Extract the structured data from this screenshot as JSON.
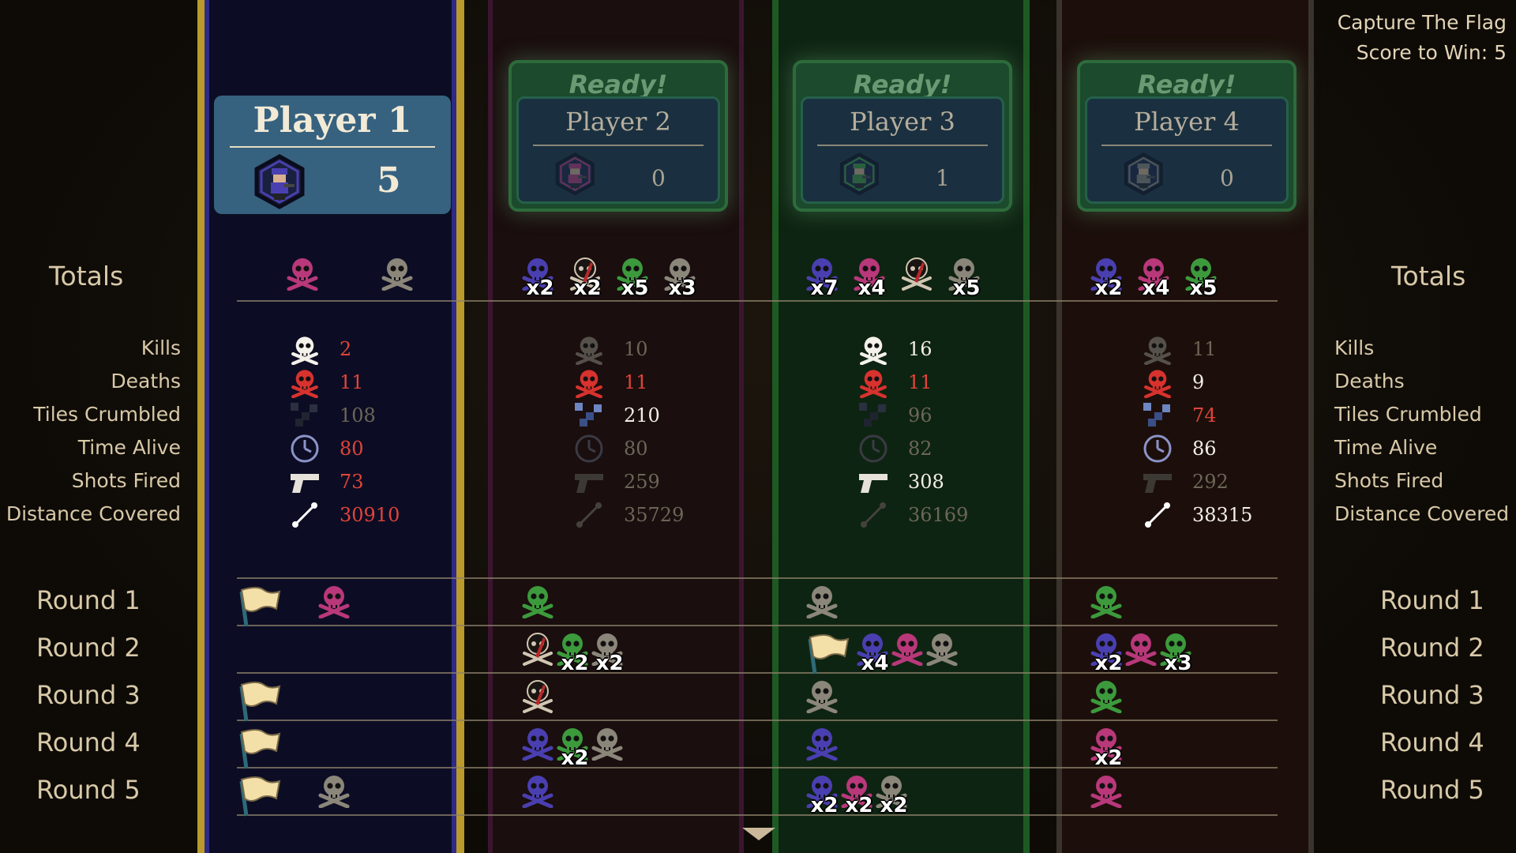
{
  "mode": {
    "title": "Capture The Flag",
    "score_to_win": "Score to Win: 5"
  },
  "labels": {
    "totals": "Totals",
    "stats": [
      "Kills",
      "Deaths",
      "Tiles Crumbled",
      "Time Alive",
      "Shots Fired",
      "Distance Covered"
    ],
    "rounds": [
      "Round 1",
      "Round 2",
      "Round 3",
      "Round 4",
      "Round 5"
    ]
  },
  "colors": {
    "purple": "#4a3fb0",
    "magenta": "#b8387a",
    "green": "#3c9a3c",
    "grey": "#8b867a",
    "red_text": "#e0443a",
    "white_text": "#f2eee4",
    "dim_text": "#6c6657"
  },
  "players": [
    {
      "name": "Player 1",
      "score": "5",
      "ready": "",
      "active": true,
      "column_color": "purple",
      "totals": [
        {
          "color": "magenta",
          "mult": ""
        },
        {
          "color": "grey",
          "mult": ""
        }
      ],
      "stats": [
        {
          "icon": "skull-icon",
          "value": "2",
          "tone": "red"
        },
        {
          "icon": "red-skull-icon",
          "value": "11",
          "tone": "red"
        },
        {
          "icon": "tiles-icon",
          "value": "108",
          "tone": "dim"
        },
        {
          "icon": "clock-icon",
          "value": "80",
          "tone": "red"
        },
        {
          "icon": "pistol-icon",
          "value": "73",
          "tone": "red"
        },
        {
          "icon": "distance-icon",
          "value": "30910",
          "tone": "red"
        }
      ],
      "rounds": [
        {
          "flag": true,
          "tokens": [
            {
              "color": "magenta",
              "mult": ""
            }
          ]
        },
        {
          "flag": false,
          "tokens": []
        },
        {
          "flag": true,
          "tokens": []
        },
        {
          "flag": true,
          "tokens": []
        },
        {
          "flag": true,
          "tokens": [
            {
              "color": "grey",
              "mult": ""
            }
          ]
        }
      ]
    },
    {
      "name": "Player 2",
      "score": "0",
      "ready": "Ready!",
      "active": false,
      "column_color": "magenta",
      "totals": [
        {
          "color": "purple",
          "mult": "x2"
        },
        {
          "color": "self",
          "mult": "x2"
        },
        {
          "color": "green",
          "mult": "x5"
        },
        {
          "color": "grey",
          "mult": "x3"
        }
      ],
      "stats": [
        {
          "icon": "skull-icon",
          "value": "10",
          "tone": "dim"
        },
        {
          "icon": "red-skull-icon",
          "value": "11",
          "tone": "red"
        },
        {
          "icon": "tiles-icon",
          "value": "210",
          "tone": "white"
        },
        {
          "icon": "clock-icon",
          "value": "80",
          "tone": "dim"
        },
        {
          "icon": "pistol-icon",
          "value": "259",
          "tone": "dim"
        },
        {
          "icon": "distance-icon",
          "value": "35729",
          "tone": "dim"
        }
      ],
      "rounds": [
        {
          "flag": false,
          "tokens": [
            {
              "color": "green",
              "mult": ""
            }
          ]
        },
        {
          "flag": false,
          "tokens": [
            {
              "color": "self",
              "mult": ""
            },
            {
              "color": "green",
              "mult": "x2"
            },
            {
              "color": "grey",
              "mult": "x2"
            }
          ]
        },
        {
          "flag": false,
          "tokens": [
            {
              "color": "self",
              "mult": ""
            }
          ]
        },
        {
          "flag": false,
          "tokens": [
            {
              "color": "purple",
              "mult": ""
            },
            {
              "color": "green",
              "mult": "x2"
            },
            {
              "color": "grey",
              "mult": ""
            }
          ]
        },
        {
          "flag": false,
          "tokens": [
            {
              "color": "purple",
              "mult": ""
            }
          ]
        }
      ]
    },
    {
      "name": "Player 3",
      "score": "1",
      "ready": "Ready!",
      "active": false,
      "column_color": "green",
      "totals": [
        {
          "color": "purple",
          "mult": "x7"
        },
        {
          "color": "magenta",
          "mult": "x4"
        },
        {
          "color": "self",
          "mult": ""
        },
        {
          "color": "grey",
          "mult": "x5"
        }
      ],
      "stats": [
        {
          "icon": "skull-icon",
          "value": "16",
          "tone": "white"
        },
        {
          "icon": "red-skull-icon",
          "value": "11",
          "tone": "red"
        },
        {
          "icon": "tiles-icon",
          "value": "96",
          "tone": "dim"
        },
        {
          "icon": "clock-icon",
          "value": "82",
          "tone": "dim"
        },
        {
          "icon": "pistol-icon",
          "value": "308",
          "tone": "white"
        },
        {
          "icon": "distance-icon",
          "value": "36169",
          "tone": "dim"
        }
      ],
      "rounds": [
        {
          "flag": false,
          "tokens": [
            {
              "color": "grey",
              "mult": ""
            }
          ]
        },
        {
          "flag": true,
          "tokens": [
            {
              "color": "purple",
              "mult": "x4"
            },
            {
              "color": "magenta",
              "mult": ""
            },
            {
              "color": "grey",
              "mult": ""
            }
          ]
        },
        {
          "flag": false,
          "tokens": [
            {
              "color": "grey",
              "mult": ""
            }
          ]
        },
        {
          "flag": false,
          "tokens": [
            {
              "color": "purple",
              "mult": ""
            }
          ]
        },
        {
          "flag": false,
          "tokens": [
            {
              "color": "purple",
              "mult": "x2"
            },
            {
              "color": "magenta",
              "mult": "x2"
            },
            {
              "color": "grey",
              "mult": "x2"
            }
          ]
        }
      ]
    },
    {
      "name": "Player 4",
      "score": "0",
      "ready": "Ready!",
      "active": false,
      "column_color": "grey",
      "totals": [
        {
          "color": "purple",
          "mult": "x2"
        },
        {
          "color": "magenta",
          "mult": "x4"
        },
        {
          "color": "green",
          "mult": "x5"
        }
      ],
      "stats": [
        {
          "icon": "skull-icon",
          "value": "11",
          "tone": "dim"
        },
        {
          "icon": "red-skull-icon",
          "value": "9",
          "tone": "white"
        },
        {
          "icon": "tiles-icon",
          "value": "74",
          "tone": "red"
        },
        {
          "icon": "clock-icon",
          "value": "86",
          "tone": "white"
        },
        {
          "icon": "pistol-icon",
          "value": "292",
          "tone": "dim"
        },
        {
          "icon": "distance-icon",
          "value": "38315",
          "tone": "white"
        }
      ],
      "rounds": [
        {
          "flag": false,
          "tokens": [
            {
              "color": "green",
              "mult": ""
            }
          ]
        },
        {
          "flag": false,
          "tokens": [
            {
              "color": "purple",
              "mult": "x2"
            },
            {
              "color": "magenta",
              "mult": ""
            },
            {
              "color": "green",
              "mult": "x3"
            }
          ]
        },
        {
          "flag": false,
          "tokens": [
            {
              "color": "green",
              "mult": ""
            }
          ]
        },
        {
          "flag": false,
          "tokens": [
            {
              "color": "magenta",
              "mult": "x2"
            }
          ]
        },
        {
          "flag": false,
          "tokens": [
            {
              "color": "magenta",
              "mult": ""
            }
          ]
        }
      ]
    }
  ]
}
